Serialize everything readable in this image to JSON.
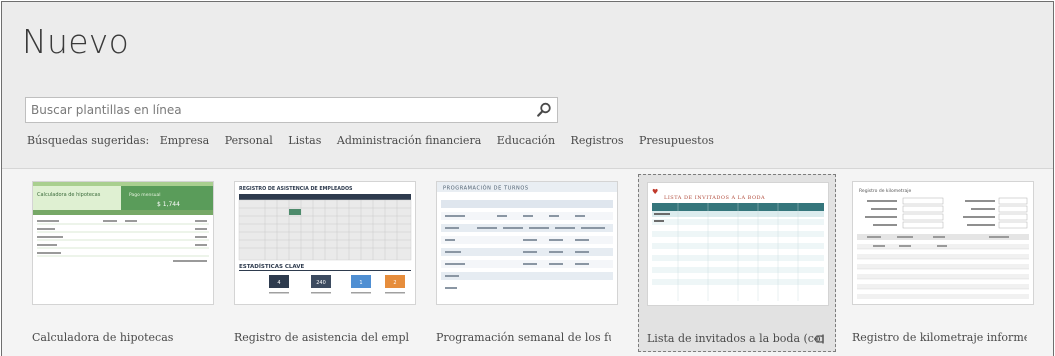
{
  "page": {
    "title": "Nuevo"
  },
  "search": {
    "placeholder": "Buscar plantillas en línea",
    "value": ""
  },
  "suggested": {
    "lead": "Búsquedas sugeridas:",
    "items": [
      "Empresa",
      "Personal",
      "Listas",
      "Administración financiera",
      "Educación",
      "Registros",
      "Presupuestos"
    ]
  },
  "templates": [
    {
      "caption": "Calculadora de hipotecas",
      "thumb": {
        "heading": "Calculadora de hipotecas",
        "sub": "Pago mensual",
        "amount": "$ 1,744"
      }
    },
    {
      "caption": "Registro de asistencia del emple...",
      "thumb": {
        "heading": "REGISTRO DE ASISTENCIA DE EMPLEADOS",
        "stats_title": "ESTADÍSTICAS CLAVE",
        "stats": [
          "4",
          "240",
          "1",
          "2"
        ]
      }
    },
    {
      "caption": "Programación semanal de los fu...",
      "thumb": {
        "heading": "PROGRAMACIÓN DE TURNOS"
      }
    },
    {
      "caption": "Lista de invitados a la boda (con...",
      "selected": true,
      "thumb": {
        "heading": "LISTA DE INVITADOS A LA BODA"
      }
    },
    {
      "caption": "Registro de kilometraje informe...",
      "thumb": {
        "heading": "Registro de kilometraje"
      }
    }
  ],
  "colors": {
    "green": "#5a9c5a",
    "teal": "#35767c",
    "navy": "#2e3b4e",
    "orange": "#e68d3c",
    "blue": "#4f8fd3",
    "red": "#c0392b"
  },
  "icons": {
    "search": "magnifier-icon",
    "pin": "pin-icon"
  }
}
